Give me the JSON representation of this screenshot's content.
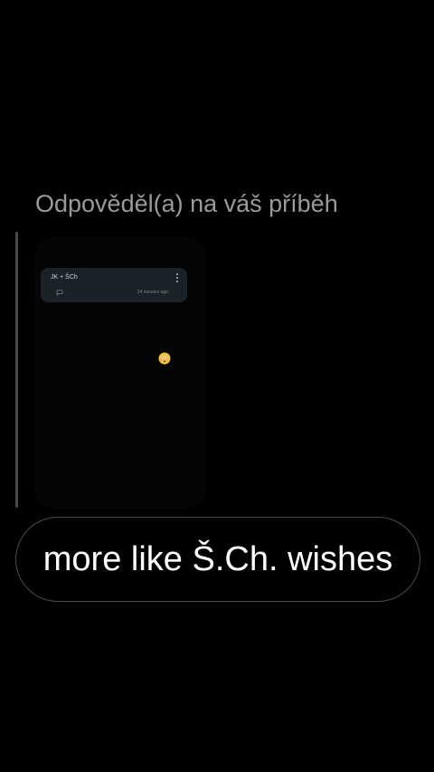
{
  "reply": {
    "header": "Odpověděl(a) na váš příběh",
    "message": "more like Š.Ch. wishes"
  },
  "story": {
    "card_title": "JK + ŠCh",
    "card_time": "24 minutes ago",
    "icons": [
      "more-vertical-icon",
      "comment-icon",
      "flushed-face-emoji"
    ]
  },
  "colors": {
    "background": "#000000",
    "header_text": "#9a9a9a",
    "card_background": "#1b2128",
    "bubble_border": "#4a4a4a"
  }
}
